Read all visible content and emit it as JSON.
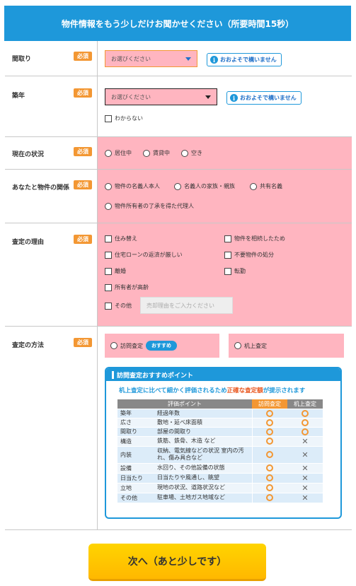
{
  "header": {
    "title": "物件情報をもう少しだけお聞かせください（所要時間15秒）"
  },
  "required_label": "必須",
  "layout": {
    "label": "間取り",
    "select_placeholder": "お選びください",
    "info_button": "おおよそで構いません"
  },
  "age": {
    "label": "築年",
    "select_placeholder": "お選びください",
    "info_button": "おおよそで構いません",
    "unknown_label": "わからない"
  },
  "status": {
    "label": "現在の状況",
    "options": [
      "居住中",
      "賃貸中",
      "空き"
    ]
  },
  "relation": {
    "label": "あなたと物件の関係",
    "options": [
      "物件の名義人本人",
      "名義人の家族・親族",
      "共有名義",
      "物件所有者の了承を得た代理人"
    ]
  },
  "reason": {
    "label": "査定の理由",
    "options": [
      "住み替え",
      "物件を相続したため",
      "住宅ローンの返済が厳しい",
      "不要物件の処分",
      "離婚",
      "転勤",
      "所有者が高齢",
      "その他"
    ],
    "other_placeholder": "売却理由をご入力ください"
  },
  "method": {
    "label": "査定の方法",
    "visit_label": "訪問査定",
    "recommend_badge": "おすすめ",
    "desk_label": "机上査定",
    "panel_title": "訪問査定おすすめポイント",
    "panel_sub_before": "机上査定に比べて細かく評価されるため",
    "panel_sub_em": "正確な査定額",
    "panel_sub_after": "が提示されます",
    "table_headers": [
      "評価ポイント",
      "訪問査定",
      "机上査定"
    ],
    "table_rows": [
      {
        "cat": "築年",
        "desc": "経過年数",
        "visit": "circle",
        "desk": "circle"
      },
      {
        "cat": "広さ",
        "desc": "敷地・延べ床面積",
        "visit": "circle",
        "desk": "circle"
      },
      {
        "cat": "間取り",
        "desc": "部屋の間取り",
        "visit": "circle",
        "desk": "circle"
      },
      {
        "cat": "構造",
        "desc": "鉄筋、鉄骨、木造 など",
        "visit": "circle",
        "desk": "cross"
      },
      {
        "cat": "内装",
        "desc": "収納、電気線などの状況 室内の汚れ、傷み具合など",
        "visit": "circle",
        "desk": "cross"
      },
      {
        "cat": "設備",
        "desc": "水回り、その他設備の状態",
        "visit": "circle",
        "desk": "cross"
      },
      {
        "cat": "日当たり",
        "desc": "日当たりや風通し、眺望",
        "visit": "circle",
        "desk": "cross"
      },
      {
        "cat": "立地",
        "desc": "現地の状況、道路状況など",
        "visit": "circle",
        "desk": "cross"
      },
      {
        "cat": "その他",
        "desc": "駐車場、土地ガス地域など",
        "visit": "circle",
        "desk": "cross"
      }
    ]
  },
  "next_button": "次へ（あと少しです）",
  "colors": {
    "header_blue": "#1e98da",
    "required_orange": "#f39733",
    "pink_field": "#ffb5c0",
    "next_yellow": "#ffc800"
  }
}
